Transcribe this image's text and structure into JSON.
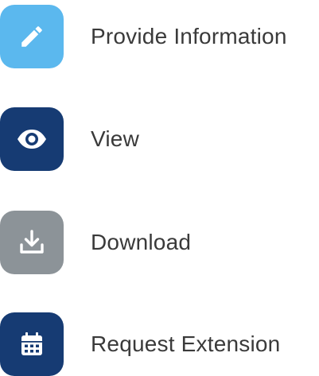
{
  "actions": [
    {
      "label": "Provide Information",
      "icon": "pencil-icon",
      "color": "#5bb8ee"
    },
    {
      "label": "View",
      "icon": "eye-icon",
      "color": "#163b73"
    },
    {
      "label": "Download",
      "icon": "download-icon",
      "color": "#8c9398"
    },
    {
      "label": "Request Extension",
      "icon": "calendar-icon",
      "color": "#163b73"
    }
  ]
}
